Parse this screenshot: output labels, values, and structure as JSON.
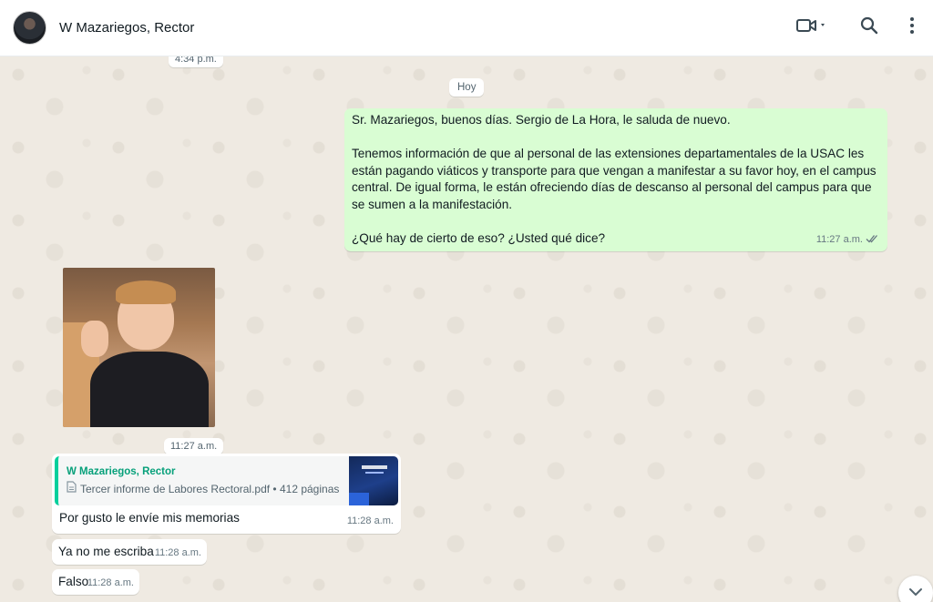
{
  "header": {
    "contact_name": "W Mazariegos, Rector",
    "avatar_icon": "contact-avatar",
    "video_icon": "video-call-icon",
    "search_icon": "search-icon",
    "menu_icon": "more-options-icon"
  },
  "chat": {
    "top_timestamp": "4:34 p.m.",
    "date_chip": "Hoy",
    "outgoing_message": {
      "lines": [
        "Sr. Mazariegos, buenos días. Sergio de La Hora, le saluda de nuevo.",
        "Tenemos información de que al personal de las extensiones departamentales de la USAC les están pagando viáticos y transporte para que vengan a manifestar a su favor hoy, en el campus central. De igual forma, le están ofreciendo días de descanso al personal del campus para que se sumen a la manifestación.",
        "¿Qué hay de cierto de eso? ¿Usted qué dice?"
      ],
      "time": "11:27 a.m.",
      "status": "read"
    },
    "image_message": {
      "time": "11:27 a.m."
    },
    "document_message": {
      "author": "W Mazariegos, Rector",
      "file_name": "Tercer informe de Labores Rectoral.pdf • 412 páginas",
      "caption": "Por gusto le envíe mis memorias",
      "time": "11:28 a.m."
    },
    "incoming_messages": [
      {
        "text": "Ya no me escriba",
        "time": "11:28 a.m."
      },
      {
        "text": "Falso",
        "time": "11:28 a.m."
      }
    ]
  },
  "colors": {
    "outgoing_bubble": "#d9fdd3",
    "incoming_bubble": "#ffffff",
    "chat_background": "#efeae2",
    "accent": "#06cf9c"
  }
}
